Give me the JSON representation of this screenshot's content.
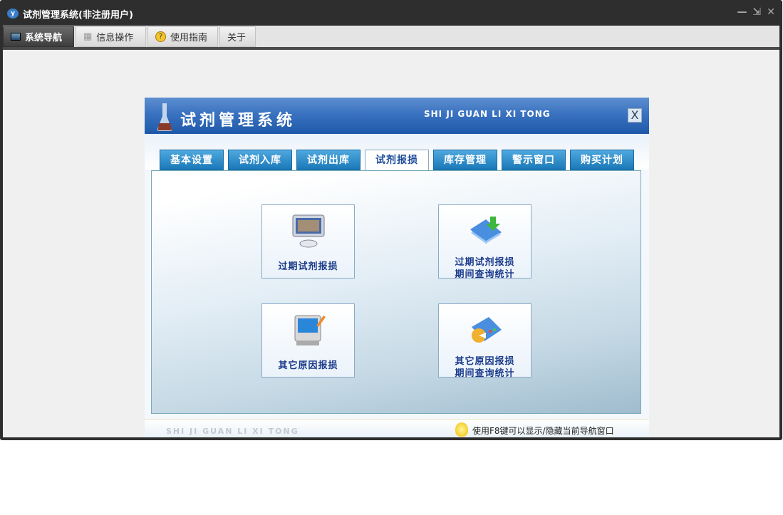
{
  "window": {
    "title": "试剂管理系统(非注册用户)",
    "controls": [
      "—",
      "⇲",
      "✕"
    ]
  },
  "top_tabs": [
    {
      "label": "系统导航",
      "icon": "monitor-icon",
      "active": true
    },
    {
      "label": "信息操作",
      "icon": "grid-icon"
    },
    {
      "label": "使用指南",
      "icon": "help-icon"
    },
    {
      "label": "关于"
    }
  ],
  "panel": {
    "title": "试剂管理系统",
    "subtitle": "SHI JI GUAN LI XI TONG",
    "close": "X",
    "tabs": [
      "基本设置",
      "试剂入库",
      "试剂出库",
      "试剂报损",
      "库存管理",
      "警示窗口",
      "购买计划"
    ],
    "active_tab": "试剂报损",
    "buttons": [
      {
        "line1": "过期试剂报损",
        "line2": ""
      },
      {
        "line1": "过期试剂报损",
        "line2": "期间查询统计"
      },
      {
        "line1": "其它原因报损",
        "line2": ""
      },
      {
        "line1": "其它原因报损",
        "line2": "期间查询统计"
      }
    ],
    "footer_en": "SHI JI GUAN LI XI TONG",
    "footer_tip": "使用F8键可以显示/隐藏当前导航窗口"
  }
}
